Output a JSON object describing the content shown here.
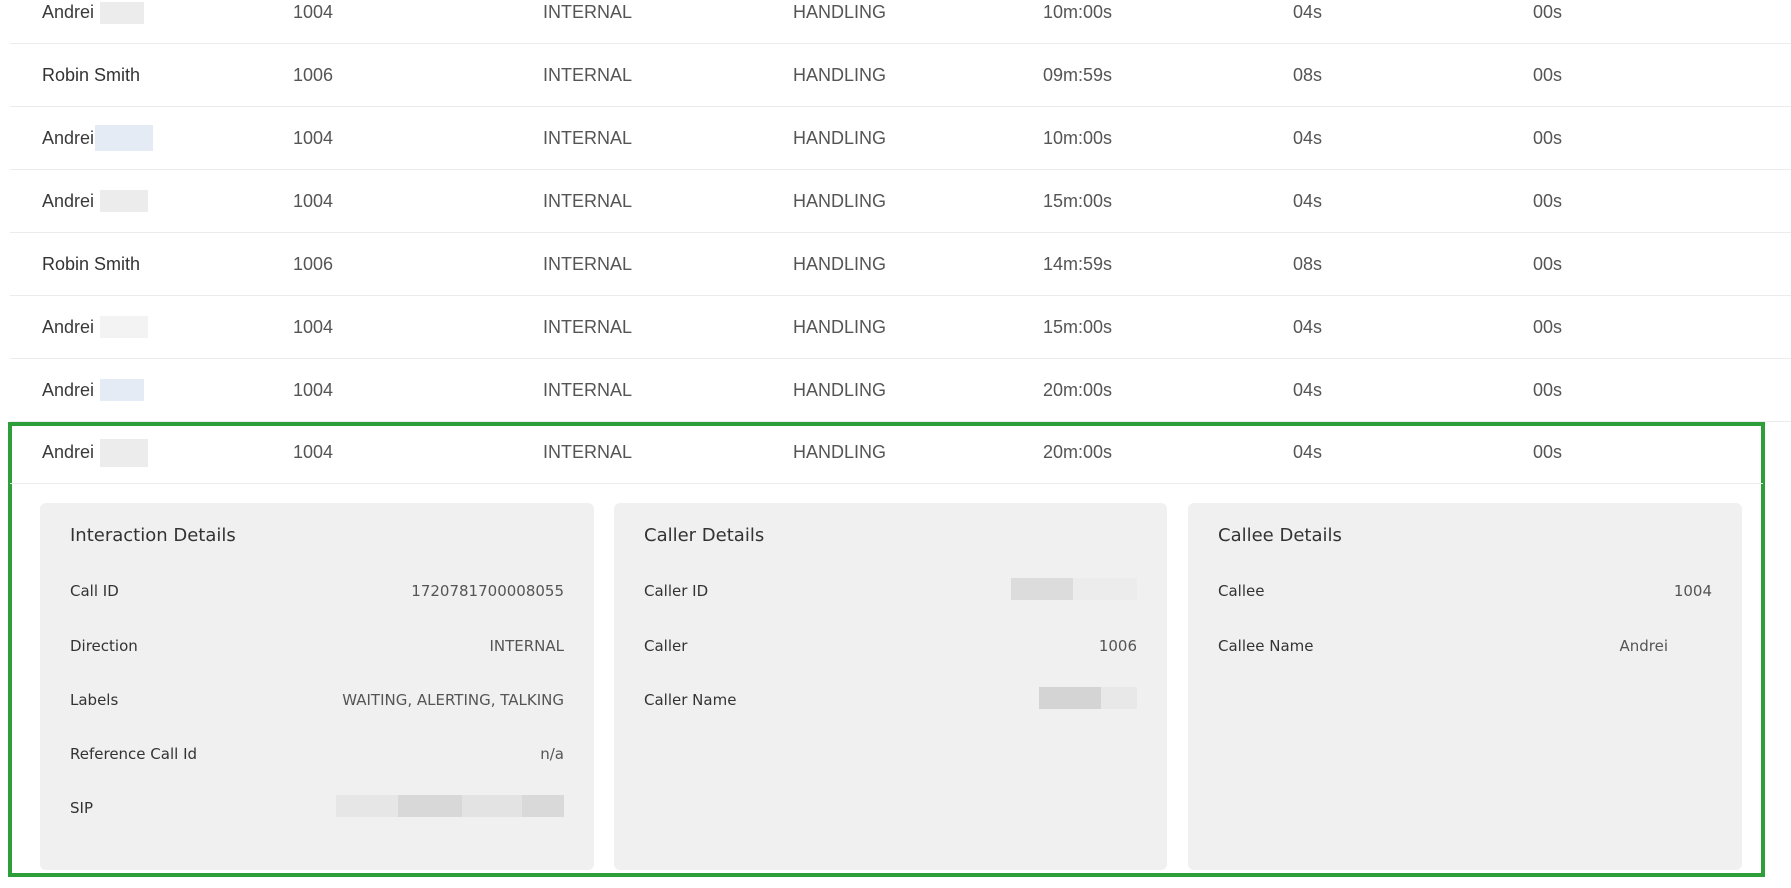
{
  "rows": [
    {
      "agent": "Andrei",
      "ext": "1004",
      "direction": "INTERNAL",
      "state": "HANDLING",
      "duration": "10m:00s",
      "wait": "04s",
      "hold": "00s"
    },
    {
      "agent": "Robin Smith",
      "ext": "1006",
      "direction": "INTERNAL",
      "state": "HANDLING",
      "duration": "09m:59s",
      "wait": "08s",
      "hold": "00s"
    },
    {
      "agent": "Andrei",
      "ext": "1004",
      "direction": "INTERNAL",
      "state": "HANDLING",
      "duration": "10m:00s",
      "wait": "04s",
      "hold": "00s"
    },
    {
      "agent": "Andrei",
      "ext": "1004",
      "direction": "INTERNAL",
      "state": "HANDLING",
      "duration": "15m:00s",
      "wait": "04s",
      "hold": "00s"
    },
    {
      "agent": "Robin Smith",
      "ext": "1006",
      "direction": "INTERNAL",
      "state": "HANDLING",
      "duration": "14m:59s",
      "wait": "08s",
      "hold": "00s"
    },
    {
      "agent": "Andrei",
      "ext": "1004",
      "direction": "INTERNAL",
      "state": "HANDLING",
      "duration": "15m:00s",
      "wait": "04s",
      "hold": "00s"
    },
    {
      "agent": "Andrei",
      "ext": "1004",
      "direction": "INTERNAL",
      "state": "HANDLING",
      "duration": "20m:00s",
      "wait": "04s",
      "hold": "00s"
    },
    {
      "agent": "Andrei",
      "ext": "1004",
      "direction": "INTERNAL",
      "state": "HANDLING",
      "duration": "20m:00s",
      "wait": "04s",
      "hold": "00s"
    }
  ],
  "interaction": {
    "title": "Interaction Details",
    "call_id_label": "Call ID",
    "call_id": "1720781700008055",
    "direction_label": "Direction",
    "direction": "INTERNAL",
    "labels_label": "Labels",
    "labels": "WAITING, ALERTING, TALKING",
    "ref_label": "Reference Call Id",
    "ref": "n/a",
    "sip_label": "SIP"
  },
  "caller": {
    "title": "Caller Details",
    "caller_id_label": "Caller ID",
    "caller_label": "Caller",
    "caller": "1006",
    "caller_name_label": "Caller Name"
  },
  "callee": {
    "title": "Callee Details",
    "callee_label": "Callee",
    "callee": "1004",
    "callee_name_label": "Callee Name",
    "callee_name": "Andrei"
  }
}
